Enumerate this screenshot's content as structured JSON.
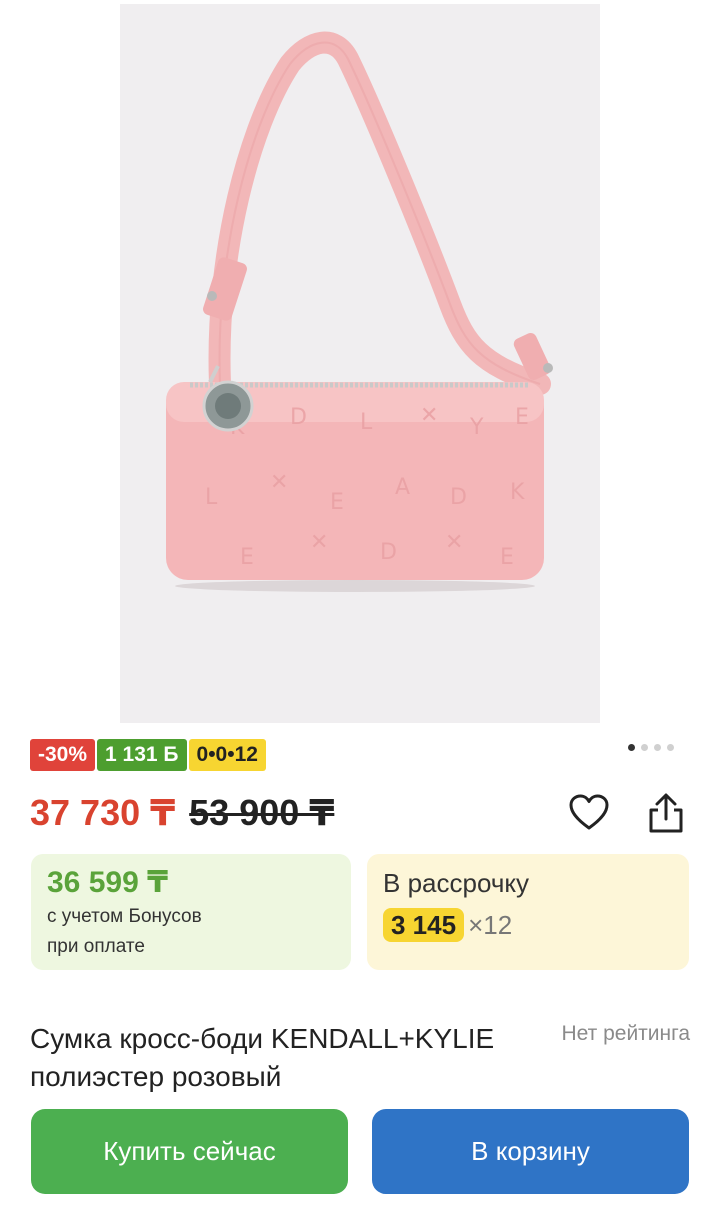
{
  "product": {
    "image_alt": "Сумка кросс-боди KENDALL+KYLIE полиэстер розовый",
    "badges": {
      "discount": "-30%",
      "bonus": "1 131 Б",
      "installment": "0•0•12"
    },
    "gallery": {
      "total_images": 4,
      "active_index": 0
    },
    "price": {
      "current": "37 730 ₸",
      "old": "53 900 ₸"
    },
    "bonus_card": {
      "price": "36 599 ₸",
      "note_line1": "с учетом Бонусов",
      "note_line2": "при оплате"
    },
    "installment_card": {
      "title": "В рассрочку",
      "amount": "3 145",
      "multiplier": "×12"
    },
    "title": "Сумка кросс-боди KENDALL+KYLIE полиэстер розовый",
    "rating": "Нет рейтинга",
    "buttons": {
      "buy_now": "Купить сейчас",
      "add_to_cart": "В корзину"
    }
  },
  "colors": {
    "discount": "#e0433a",
    "bonus": "#4d9e2f",
    "installment": "#f7d531",
    "price": "#d9432f",
    "buy": "#4caf50",
    "cart": "#2f74c6"
  },
  "icons": {
    "favorite": "heart-icon",
    "share": "share-icon"
  }
}
